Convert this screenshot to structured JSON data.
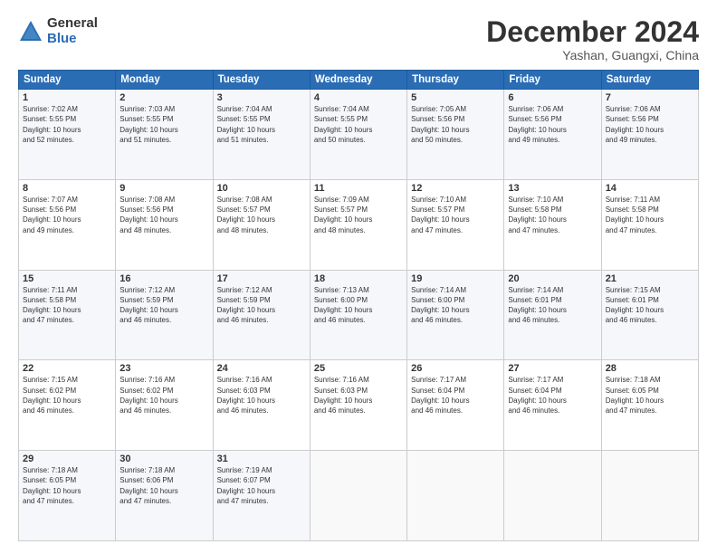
{
  "logo": {
    "general": "General",
    "blue": "Blue"
  },
  "header": {
    "month": "December 2024",
    "location": "Yashan, Guangxi, China"
  },
  "days_of_week": [
    "Sunday",
    "Monday",
    "Tuesday",
    "Wednesday",
    "Thursday",
    "Friday",
    "Saturday"
  ],
  "weeks": [
    [
      {
        "day": "1",
        "info": "Sunrise: 7:02 AM\nSunset: 5:55 PM\nDaylight: 10 hours\nand 52 minutes."
      },
      {
        "day": "2",
        "info": "Sunrise: 7:03 AM\nSunset: 5:55 PM\nDaylight: 10 hours\nand 51 minutes."
      },
      {
        "day": "3",
        "info": "Sunrise: 7:04 AM\nSunset: 5:55 PM\nDaylight: 10 hours\nand 51 minutes."
      },
      {
        "day": "4",
        "info": "Sunrise: 7:04 AM\nSunset: 5:55 PM\nDaylight: 10 hours\nand 50 minutes."
      },
      {
        "day": "5",
        "info": "Sunrise: 7:05 AM\nSunset: 5:56 PM\nDaylight: 10 hours\nand 50 minutes."
      },
      {
        "day": "6",
        "info": "Sunrise: 7:06 AM\nSunset: 5:56 PM\nDaylight: 10 hours\nand 49 minutes."
      },
      {
        "day": "7",
        "info": "Sunrise: 7:06 AM\nSunset: 5:56 PM\nDaylight: 10 hours\nand 49 minutes."
      }
    ],
    [
      {
        "day": "8",
        "info": "Sunrise: 7:07 AM\nSunset: 5:56 PM\nDaylight: 10 hours\nand 49 minutes."
      },
      {
        "day": "9",
        "info": "Sunrise: 7:08 AM\nSunset: 5:56 PM\nDaylight: 10 hours\nand 48 minutes."
      },
      {
        "day": "10",
        "info": "Sunrise: 7:08 AM\nSunset: 5:57 PM\nDaylight: 10 hours\nand 48 minutes."
      },
      {
        "day": "11",
        "info": "Sunrise: 7:09 AM\nSunset: 5:57 PM\nDaylight: 10 hours\nand 48 minutes."
      },
      {
        "day": "12",
        "info": "Sunrise: 7:10 AM\nSunset: 5:57 PM\nDaylight: 10 hours\nand 47 minutes."
      },
      {
        "day": "13",
        "info": "Sunrise: 7:10 AM\nSunset: 5:58 PM\nDaylight: 10 hours\nand 47 minutes."
      },
      {
        "day": "14",
        "info": "Sunrise: 7:11 AM\nSunset: 5:58 PM\nDaylight: 10 hours\nand 47 minutes."
      }
    ],
    [
      {
        "day": "15",
        "info": "Sunrise: 7:11 AM\nSunset: 5:58 PM\nDaylight: 10 hours\nand 47 minutes."
      },
      {
        "day": "16",
        "info": "Sunrise: 7:12 AM\nSunset: 5:59 PM\nDaylight: 10 hours\nand 46 minutes."
      },
      {
        "day": "17",
        "info": "Sunrise: 7:12 AM\nSunset: 5:59 PM\nDaylight: 10 hours\nand 46 minutes."
      },
      {
        "day": "18",
        "info": "Sunrise: 7:13 AM\nSunset: 6:00 PM\nDaylight: 10 hours\nand 46 minutes."
      },
      {
        "day": "19",
        "info": "Sunrise: 7:14 AM\nSunset: 6:00 PM\nDaylight: 10 hours\nand 46 minutes."
      },
      {
        "day": "20",
        "info": "Sunrise: 7:14 AM\nSunset: 6:01 PM\nDaylight: 10 hours\nand 46 minutes."
      },
      {
        "day": "21",
        "info": "Sunrise: 7:15 AM\nSunset: 6:01 PM\nDaylight: 10 hours\nand 46 minutes."
      }
    ],
    [
      {
        "day": "22",
        "info": "Sunrise: 7:15 AM\nSunset: 6:02 PM\nDaylight: 10 hours\nand 46 minutes."
      },
      {
        "day": "23",
        "info": "Sunrise: 7:16 AM\nSunset: 6:02 PM\nDaylight: 10 hours\nand 46 minutes."
      },
      {
        "day": "24",
        "info": "Sunrise: 7:16 AM\nSunset: 6:03 PM\nDaylight: 10 hours\nand 46 minutes."
      },
      {
        "day": "25",
        "info": "Sunrise: 7:16 AM\nSunset: 6:03 PM\nDaylight: 10 hours\nand 46 minutes."
      },
      {
        "day": "26",
        "info": "Sunrise: 7:17 AM\nSunset: 6:04 PM\nDaylight: 10 hours\nand 46 minutes."
      },
      {
        "day": "27",
        "info": "Sunrise: 7:17 AM\nSunset: 6:04 PM\nDaylight: 10 hours\nand 46 minutes."
      },
      {
        "day": "28",
        "info": "Sunrise: 7:18 AM\nSunset: 6:05 PM\nDaylight: 10 hours\nand 47 minutes."
      }
    ],
    [
      {
        "day": "29",
        "info": "Sunrise: 7:18 AM\nSunset: 6:05 PM\nDaylight: 10 hours\nand 47 minutes."
      },
      {
        "day": "30",
        "info": "Sunrise: 7:18 AM\nSunset: 6:06 PM\nDaylight: 10 hours\nand 47 minutes."
      },
      {
        "day": "31",
        "info": "Sunrise: 7:19 AM\nSunset: 6:07 PM\nDaylight: 10 hours\nand 47 minutes."
      },
      null,
      null,
      null,
      null
    ]
  ]
}
